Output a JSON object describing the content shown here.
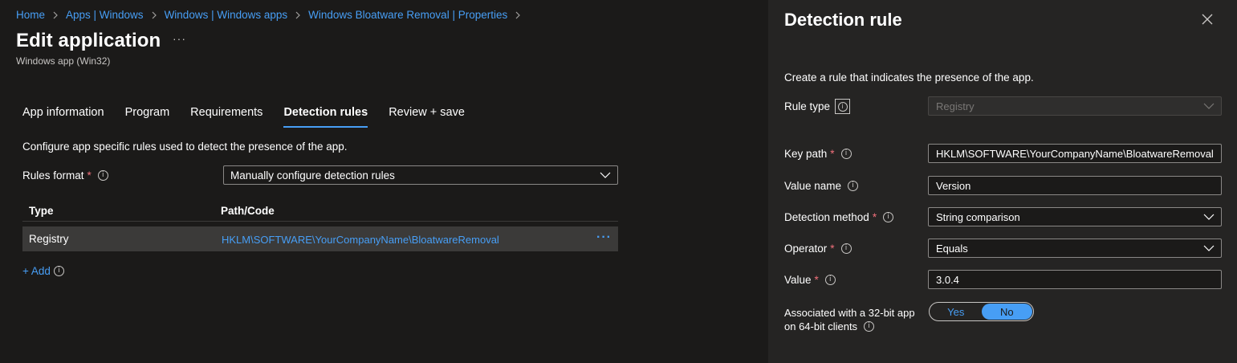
{
  "breadcrumb": [
    "Home",
    "Apps | Windows",
    "Windows | Windows apps",
    "Windows Bloatware Removal | Properties"
  ],
  "page": {
    "title": "Edit application",
    "more_label": "···",
    "subtitle": "Windows app (Win32)"
  },
  "tabs": [
    "App information",
    "Program",
    "Requirements",
    "Detection rules",
    "Review + save"
  ],
  "active_tab": "Detection rules",
  "detection": {
    "description": "Configure app specific rules used to detect the presence of the app.",
    "rules_format_label": "Rules format",
    "rules_format_value": "Manually configure detection rules",
    "table": {
      "headers": [
        "Type",
        "Path/Code"
      ],
      "rows": [
        {
          "type": "Registry",
          "path": "HKLM\\SOFTWARE\\YourCompanyName\\BloatwareRemoval",
          "menu": "···"
        }
      ]
    },
    "add_label": "+ Add"
  },
  "panel": {
    "title": "Detection rule",
    "description": "Create a rule that indicates the presence of the app.",
    "rule_type_label": "Rule type",
    "rule_type_value": "Registry",
    "key_path_label": "Key path",
    "key_path_value": "HKLM\\SOFTWARE\\YourCompanyName\\BloatwareRemoval",
    "value_name_label": "Value name",
    "value_name_value": "Version",
    "detection_method_label": "Detection method",
    "detection_method_value": "String comparison",
    "operator_label": "Operator",
    "operator_value": "Equals",
    "value_label": "Value",
    "value_value": "3.0.4",
    "assoc_label_line1": "Associated with a 32-bit app",
    "assoc_label_line2": "on 64-bit clients",
    "toggle_yes": "Yes",
    "toggle_no": "No",
    "toggle_selected": "No"
  },
  "colors": {
    "accent": "#479ef5",
    "required": "#f1707b",
    "background": "#1b1a19",
    "panel_background": "#252423"
  },
  "icons": [
    "chevron-right-icon",
    "chevron-down-icon",
    "info-icon",
    "close-icon",
    "more-icon"
  ]
}
